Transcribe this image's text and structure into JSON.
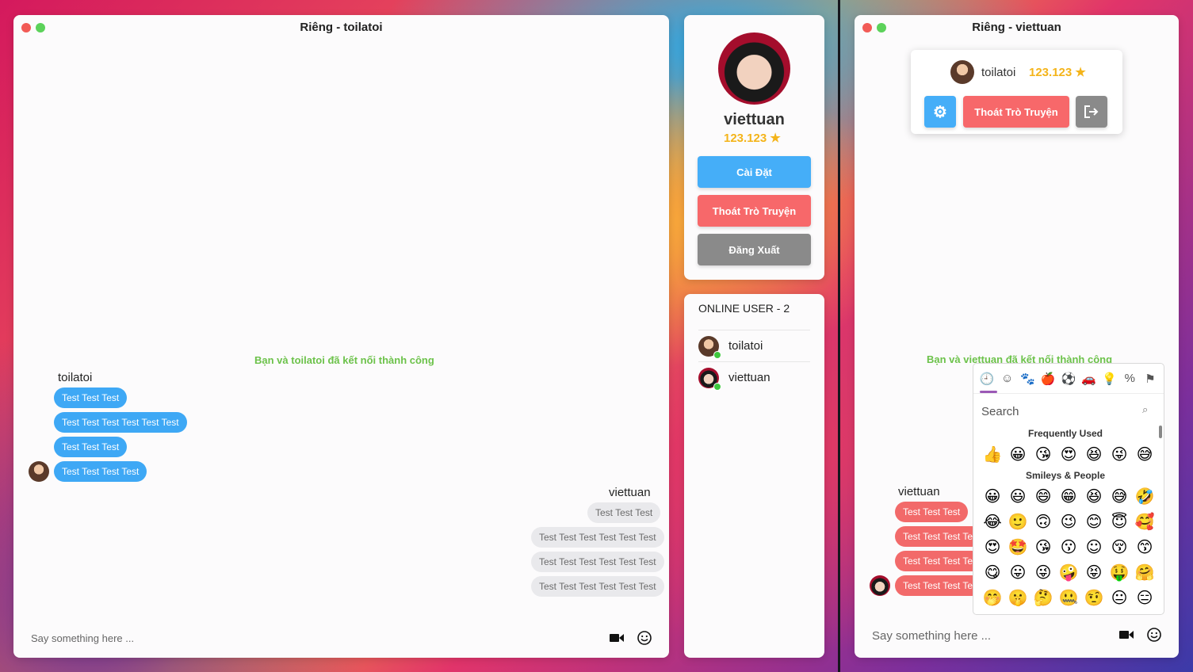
{
  "left_chat": {
    "title": "Riêng - toilatoi",
    "system_message": "Bạn và toilatoi đã kết nối thành công",
    "incoming": {
      "sender": "toilatoi",
      "messages": [
        "Test Test Test",
        "Test Test Test Test Test Test",
        "Test Test Test",
        "Test Test Test Test"
      ]
    },
    "outgoing": {
      "sender": "viettuan",
      "messages": [
        "Test Test Test",
        "Test Test Test Test Test Test",
        "Test Test Test Test Test Test",
        "Test Test Test Test Test Test"
      ]
    },
    "input_placeholder": "Say something here ..."
  },
  "profile": {
    "name": "viettuan",
    "score": "123.123",
    "settings_label": "Cài Đặt",
    "leave_label": "Thoát Trò Truyện",
    "logout_label": "Đăng Xuất"
  },
  "online": {
    "title": "ONLINE USER - 2",
    "users": [
      "toilatoi",
      "viettuan"
    ]
  },
  "right_chat": {
    "title": "Riêng - viettuan",
    "popover": {
      "name": "toilatoi",
      "score": "123.123",
      "leave_label": "Thoát Trò Truyện"
    },
    "system_message": "Bạn và viettuan đã kết nối thành công",
    "sender": "viettuan",
    "messages": [
      "Test Test Test",
      "Test Test Test Test Test Test",
      "Test Test Test Test Test Test",
      "Test Test Test Test Test Test"
    ],
    "input_placeholder": "Say something here ..."
  },
  "emoji_picker": {
    "search_placeholder": "Search",
    "section_frequent": "Frequently Used",
    "section_smileys": "Smileys & People",
    "categories": [
      "clock-icon",
      "smiley-icon",
      "animal-icon",
      "food-icon",
      "sport-icon",
      "travel-icon",
      "bulb-icon",
      "symbols-icon",
      "flag-icon"
    ],
    "frequent": [
      "👍",
      "😀",
      "😘",
      "😍",
      "😆",
      "😜",
      "😅"
    ],
    "smileys": [
      "😀",
      "😃",
      "😄",
      "😁",
      "😆",
      "😅",
      "🤣",
      "😂",
      "🙂",
      "🙃",
      "😉",
      "😊",
      "😇",
      "🥰",
      "😍",
      "🤩",
      "😘",
      "😗",
      "☺",
      "😚",
      "😙",
      "😋",
      "😛",
      "😜",
      "🤪",
      "😝",
      "🤑",
      "🤗",
      "🤭",
      "🤫",
      "🤔",
      "🤐",
      "🤨",
      "😐",
      "😑"
    ]
  },
  "colors": {
    "accent_blue": "#3ea8f5",
    "accent_red": "#f26a6a",
    "online_green": "#3ec73e",
    "score_gold": "#f4b41a"
  }
}
